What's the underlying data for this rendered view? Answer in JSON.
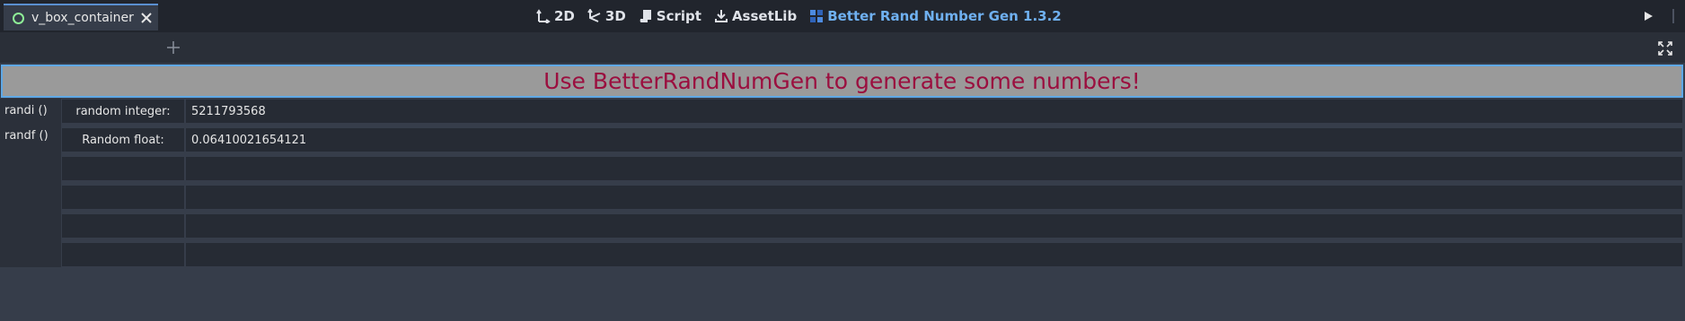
{
  "topbar": {
    "workspaces": [
      {
        "label": "2D",
        "icon": "2d-icon",
        "active": false
      },
      {
        "label": "3D",
        "icon": "3d-icon",
        "active": false
      },
      {
        "label": "Script",
        "icon": "script-icon",
        "active": false
      },
      {
        "label": "AssetLib",
        "icon": "assetlib-icon",
        "active": false
      },
      {
        "label": "Better Rand Number Gen 1.3.2",
        "icon": "plugin-icon",
        "active": true
      }
    ]
  },
  "tabs": {
    "scene_tab_label": "v_box_container"
  },
  "banner": {
    "text": "Use BetterRandNumGen to generate some numbers!"
  },
  "side_buttons": {
    "randi": "randi ()",
    "randf": "randf ()"
  },
  "rows": [
    {
      "label": "random integer:",
      "value": "5211793568"
    },
    {
      "label": "Random float:",
      "value": "0.06410021654121"
    },
    {
      "label": "",
      "value": ""
    },
    {
      "label": "",
      "value": ""
    },
    {
      "label": "",
      "value": ""
    },
    {
      "label": "",
      "value": ""
    }
  ],
  "colors": {
    "accent": "#6fb0f0",
    "banner_text": "#9b0f3f",
    "banner_bg": "#9a9a9a",
    "scene_icon": "#8eef97"
  }
}
